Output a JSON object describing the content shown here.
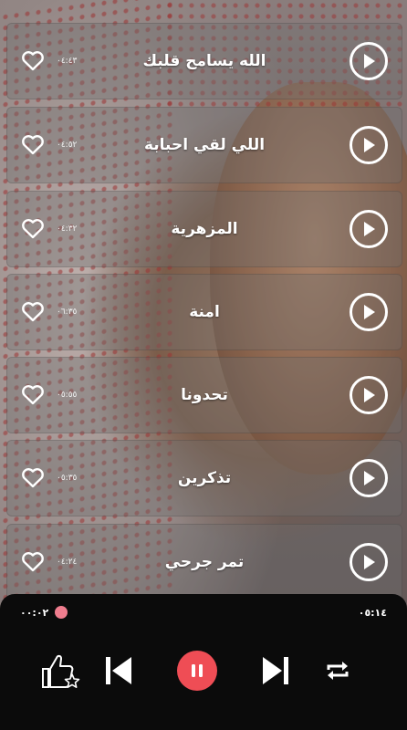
{
  "colors": {
    "row_bg": "#6e6e6e",
    "accent": "#ef4d55",
    "seek_thumb": "#ef7d8e",
    "player_bg": "#0b0b0b",
    "text": "#ffffff"
  },
  "songs": [
    {
      "title": "الله يسامح قلبك",
      "duration": "٠٤:٤٣"
    },
    {
      "title": "اللي لقي احبابة",
      "duration": "٠٤:٥٢"
    },
    {
      "title": "المزهرية",
      "duration": "٠٤:٣٢"
    },
    {
      "title": "امنة",
      "duration": "٠٦:٣٥"
    },
    {
      "title": "تحدونا",
      "duration": "٠٥:٥٥"
    },
    {
      "title": "تذكرين",
      "duration": "٠٥:٣٥"
    },
    {
      "title": "تمر جرحي",
      "duration": "٠٤:٢٤"
    }
  ],
  "player": {
    "current_time": "٠٠:٠٢",
    "total_time": "٠٥:١٤",
    "progress": 0.006,
    "controls": {
      "like": "thumbs-up-star-icon",
      "previous": "skip-previous-icon",
      "pause": "pause-icon",
      "next": "skip-next-icon",
      "repeat": "repeat-icon"
    }
  },
  "row_icons": {
    "favorite": "heart-outline-icon",
    "play": "play-circle-icon"
  }
}
